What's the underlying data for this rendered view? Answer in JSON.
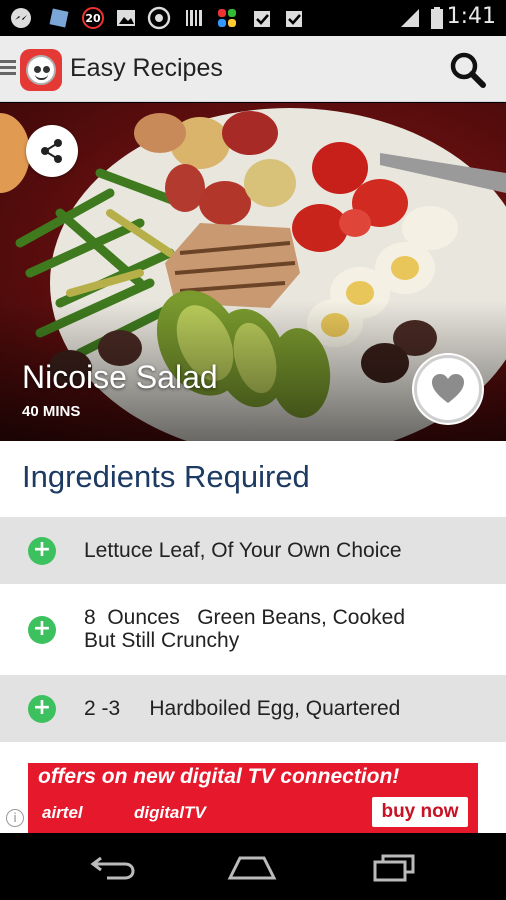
{
  "statusbar": {
    "time": "1:41",
    "notification_count": "20",
    "icons": [
      "messenger-icon",
      "shield-icon",
      "notification-20-icon",
      "image-icon",
      "whatsapp-icon",
      "barcode-icon",
      "grid-app-icon",
      "checklist-icon",
      "checklist-icon",
      "signal-icon",
      "battery-icon"
    ]
  },
  "appbar": {
    "title": "Easy Recipes",
    "menu_icon": "hamburger-icon",
    "logo_icon": "app-logo-icon",
    "search_icon": "search-icon"
  },
  "hero": {
    "recipe_name": "Nicoise Salad",
    "cook_time": "40 MINS",
    "share_icon": "share-icon",
    "favorite_icon": "heart-icon"
  },
  "ingredients": {
    "title": "Ingredients Required",
    "items": [
      {
        "text": "Lettuce Leaf, Of Your Own Choice"
      },
      {
        "text": "8  Ounces   Green Beans, Cooked\nBut Still Crunchy"
      },
      {
        "text": "2 -3     Hardboiled Egg, Quartered"
      }
    ]
  },
  "ad": {
    "headline": "offers on new digital TV connection!",
    "brand": "airtel",
    "product": "digitalTV",
    "cta": "buy now",
    "info": "i"
  },
  "navbar": {
    "back_icon": "back-icon",
    "home_icon": "home-icon",
    "recents_icon": "recents-icon"
  },
  "colors": {
    "accent_green": "#3dc15e",
    "title_blue": "#1d3a63",
    "ad_red": "#e5182c",
    "row_grey": "#e2e2e2"
  }
}
